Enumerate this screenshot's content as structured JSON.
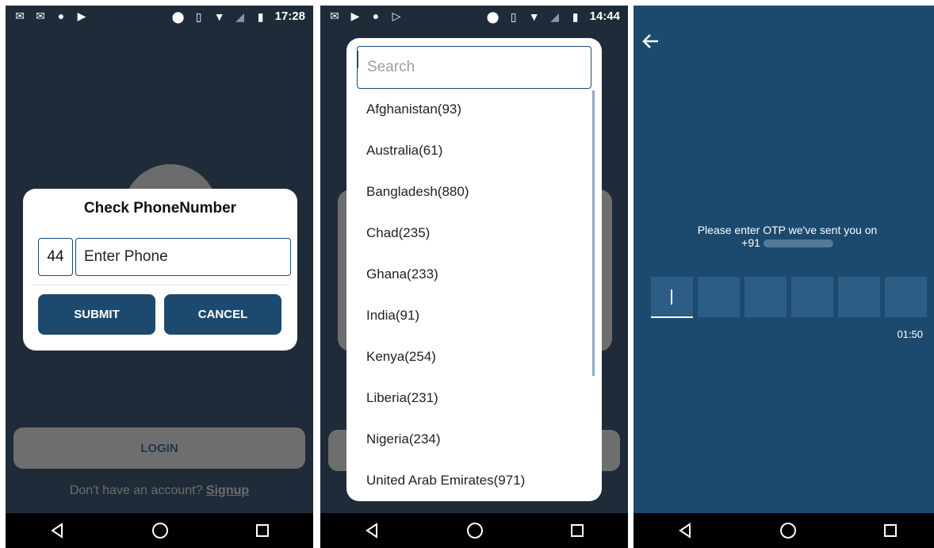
{
  "panel1": {
    "status_time": "17:28",
    "dialog": {
      "title": "Check PhoneNumber",
      "country_code": "44",
      "phone_placeholder": "Enter Phone",
      "submit_label": "SUBMIT",
      "cancel_label": "CANCEL"
    },
    "background": {
      "login_label": "LOGIN",
      "signup_prompt": "Don't have an account?",
      "signup_link": "Signup"
    }
  },
  "panel2": {
    "status_time": "14:44",
    "search_placeholder": "Search",
    "countries": [
      "Afghanistan(93)",
      "Australia(61)",
      "Bangladesh(880)",
      "Chad(235)",
      "Ghana(233)",
      "India(91)",
      "Kenya(254)",
      "Liberia(231)",
      "Nigeria(234)",
      "United Arab Emirates(971)"
    ]
  },
  "panel3": {
    "otp_message": "Please enter OTP we've sent you on",
    "phone_prefix": "+91",
    "otp_digits": [
      "",
      "",
      "",
      "",
      "",
      ""
    ],
    "timer": "01:50"
  },
  "icons": {
    "status_left_p1": [
      "mail-icon",
      "mail-icon",
      "android-icon",
      "play-icon"
    ],
    "status_left_p2": [
      "mail-icon",
      "play-icon",
      "android-icon",
      "play-outline-icon"
    ],
    "status_right": [
      "location-icon",
      "vibrate-icon",
      "wifi-icon",
      "no-sim-icon",
      "battery-charging-icon"
    ],
    "nav": [
      "back-icon",
      "home-icon",
      "recents-icon"
    ]
  },
  "colors": {
    "primary": "#1c4a6f",
    "dark_bg": "#1f2b38",
    "otp_bg": "#1c4a6f",
    "otp_box": "#2b5d86"
  }
}
